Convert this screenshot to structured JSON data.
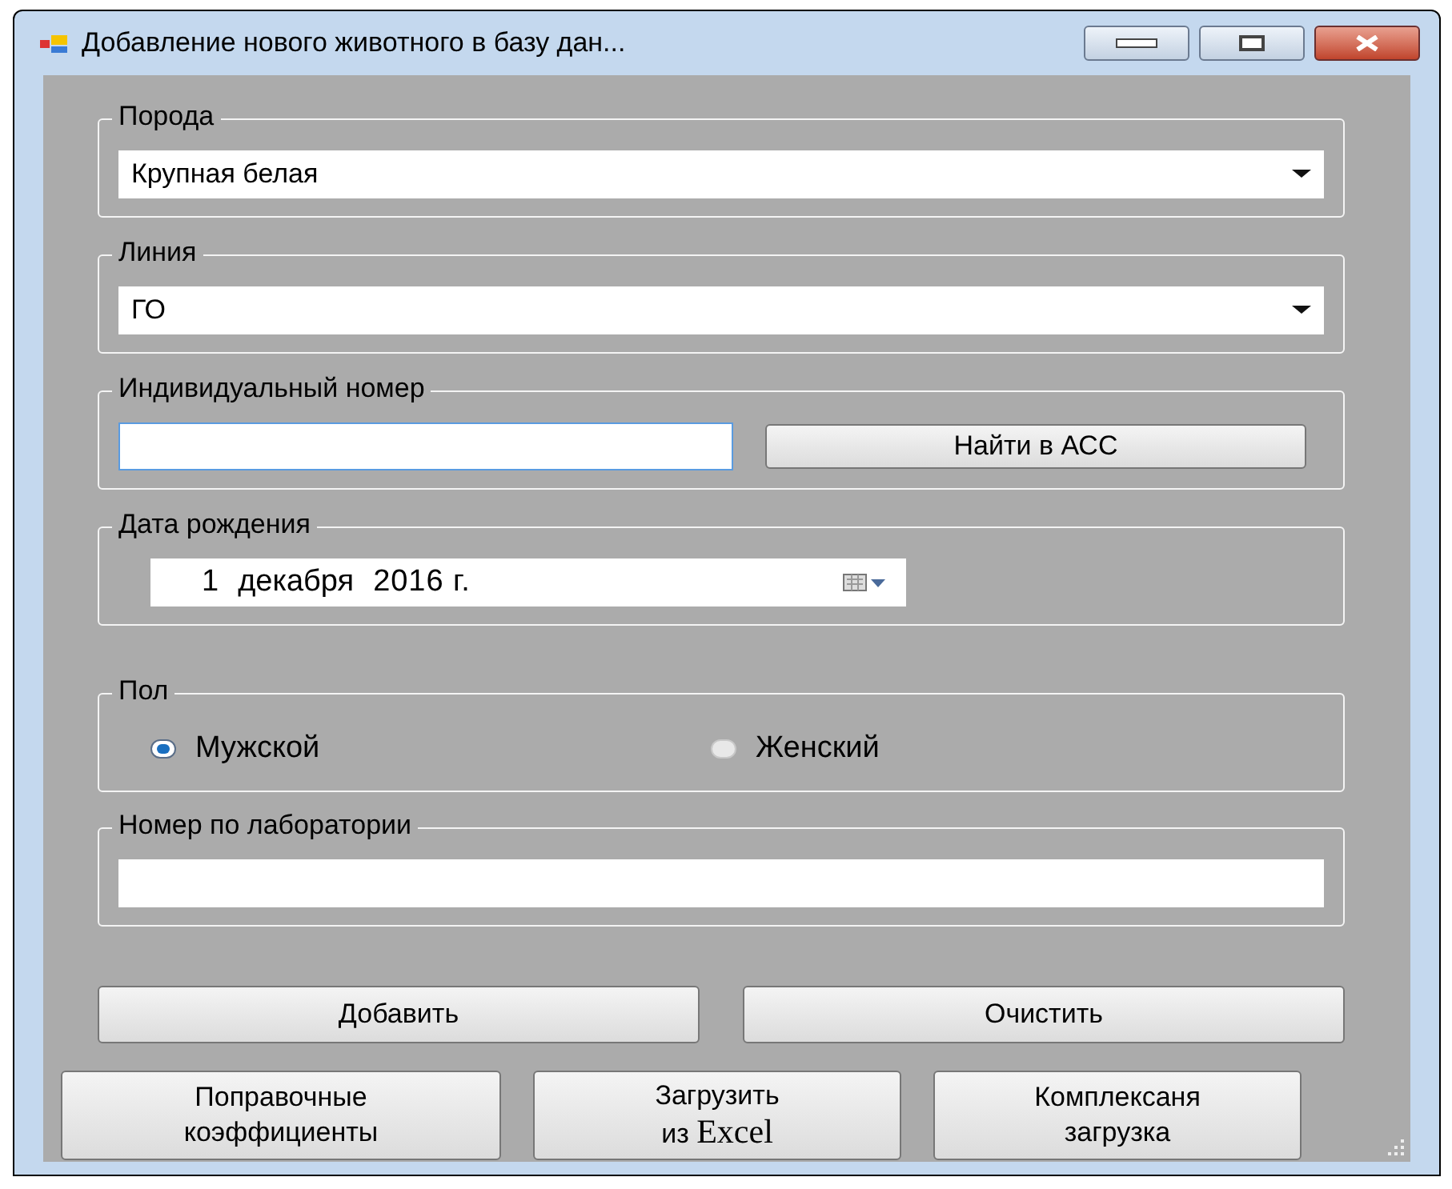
{
  "window": {
    "title": "Добавление нового животного в базу дан..."
  },
  "breed": {
    "label": "Порода",
    "value": "Крупная белая"
  },
  "line": {
    "label": "Линия",
    "value": "ГО"
  },
  "individual_number": {
    "label": "Индивидуальный номер",
    "focused": true,
    "button": "Найти в АСС"
  },
  "birth_date": {
    "label": "Дата рождения",
    "day": "1",
    "month": "декабря",
    "year": "2016 г."
  },
  "sex": {
    "label": "Пол",
    "options": [
      {
        "label": "Мужской",
        "selected": true
      },
      {
        "label": "Женский",
        "selected": false
      }
    ]
  },
  "lab_number": {
    "label": "Номер по лаборатории"
  },
  "actions": [
    {
      "label": "Добавить"
    },
    {
      "label": "Очистить"
    }
  ],
  "tools": [
    {
      "lines": [
        [
          {
            "text": "Поправочные",
            "serif": false
          }
        ],
        [
          {
            "text": "коэффициенты",
            "serif": false
          }
        ]
      ]
    },
    {
      "lines": [
        [
          {
            "text": "Загрузить",
            "serif": false
          }
        ],
        [
          {
            "text": "из ",
            "serif": false
          },
          {
            "text": "Excel",
            "serif": true
          }
        ]
      ]
    },
    {
      "lines": [
        [
          {
            "text": "Комплексаня",
            "serif": false
          }
        ],
        [
          {
            "text": "загрузка",
            "serif": false
          }
        ]
      ]
    }
  ]
}
